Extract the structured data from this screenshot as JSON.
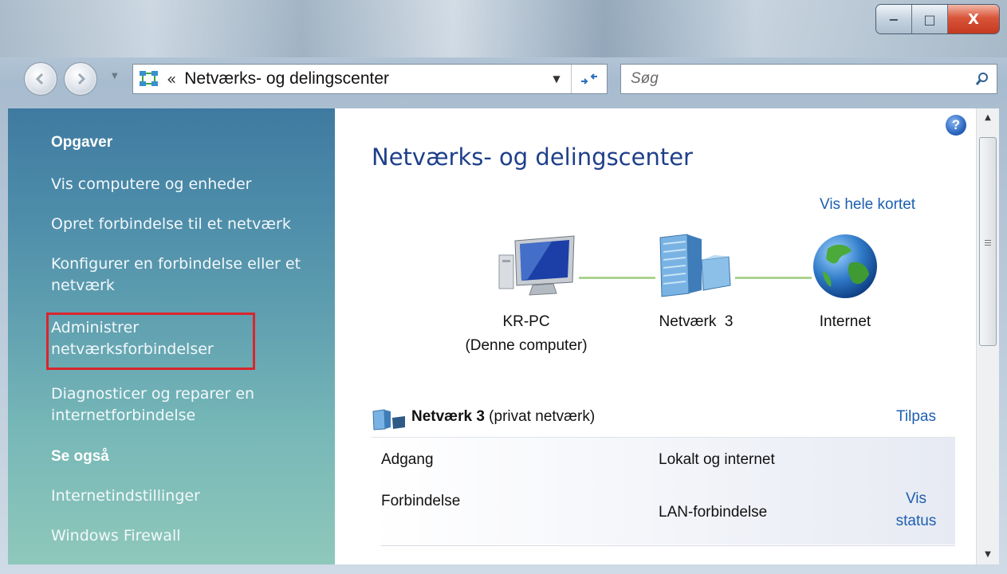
{
  "window": {
    "minimize_glyph": "−",
    "maximize_glyph": "□",
    "close_glyph": "X"
  },
  "navbar": {
    "breadcrumb_chevron": "«",
    "address": "Netværks- og delingscenter",
    "search_placeholder": "Søg"
  },
  "sidebar": {
    "tasks_heading": "Opgaver",
    "tasks": [
      "Vis computere og enheder",
      "Opret forbindelse til et netværk",
      "Konfigurer en forbindelse eller et netværk",
      "Administrer netværksforbindelser",
      "Diagnosticer og reparer en internetforbindelse"
    ],
    "see_also_heading": "Se også",
    "see_also": [
      "Internetindstillinger",
      "Windows Firewall"
    ]
  },
  "main": {
    "help_glyph": "?",
    "title": "Netværks- og delingscenter",
    "full_map_link": "Vis hele kortet",
    "nodes": {
      "computer_name": "KR-PC",
      "computer_sub": "(Denne computer)",
      "network": "Netværk  3",
      "internet": "Internet"
    },
    "network": {
      "name": "Netværk",
      "number": " 3",
      "type": " (privat netværk)",
      "customize": "Tilpas",
      "rows": [
        {
          "label": "Adgang",
          "value": "Lokalt og internet"
        },
        {
          "label": "Forbindelse",
          "value": "LAN-forbindelse"
        }
      ],
      "view_status_line1": "Vis",
      "view_status_line2": "status"
    }
  },
  "colors": {
    "link": "#1d5fb0",
    "title": "#1e3f8a",
    "highlight_box": "#d8262c"
  }
}
